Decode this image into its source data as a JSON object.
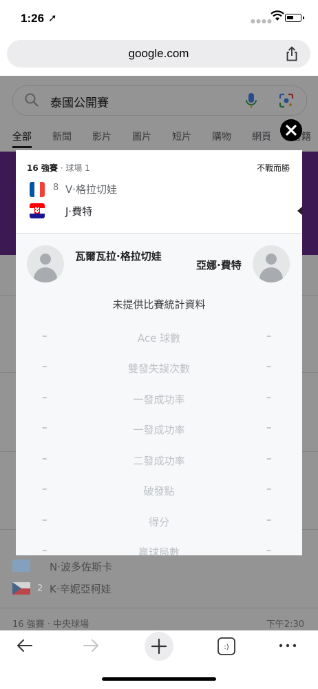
{
  "status_bar": {
    "time": "1:26",
    "location_glyph": "➚"
  },
  "browser": {
    "url": "google.com"
  },
  "search": {
    "query": "泰國公開賽"
  },
  "tabs": [
    "全部",
    "新聞",
    "影片",
    "圖片",
    "短片",
    "購物",
    "網頁",
    "書籍"
  ],
  "match": {
    "round": "16 強賽",
    "court": " · 球場 1",
    "result": "不戰而勝",
    "player1": {
      "seed": "8",
      "short": "V·格拉切娃"
    },
    "player2": {
      "short": "J·費特"
    }
  },
  "stats_panel": {
    "player_left": "瓦爾瓦拉·格拉切娃",
    "player_right": "亞娜·費特",
    "no_stats": "未提供比賽統計資料",
    "rows": [
      {
        "label": "Ace 球數",
        "left": "–",
        "right": "–"
      },
      {
        "label": "雙發失誤次數",
        "left": "–",
        "right": "–"
      },
      {
        "label": "一發成功率",
        "left": "–",
        "right": "–"
      },
      {
        "label": "一發成功率",
        "left": "–",
        "right": "–"
      },
      {
        "label": "二發成功率",
        "left": "–",
        "right": "–"
      },
      {
        "label": "破發點",
        "left": "–",
        "right": "–"
      },
      {
        "label": "得分",
        "left": "–",
        "right": "–"
      },
      {
        "label": "贏球局數",
        "left": "–",
        "right": "–"
      }
    ]
  },
  "background_list": {
    "row1": "N·波多佐斯卡",
    "row2_seed": "2",
    "row2": "K·辛妮亞柯娃",
    "next_round": "16 強賽 · 中央球場",
    "next_time": "下午2:30"
  },
  "colors": {
    "accent_purple": "#6a2c91",
    "dim": "rgba(0,0,0,0.42)"
  }
}
